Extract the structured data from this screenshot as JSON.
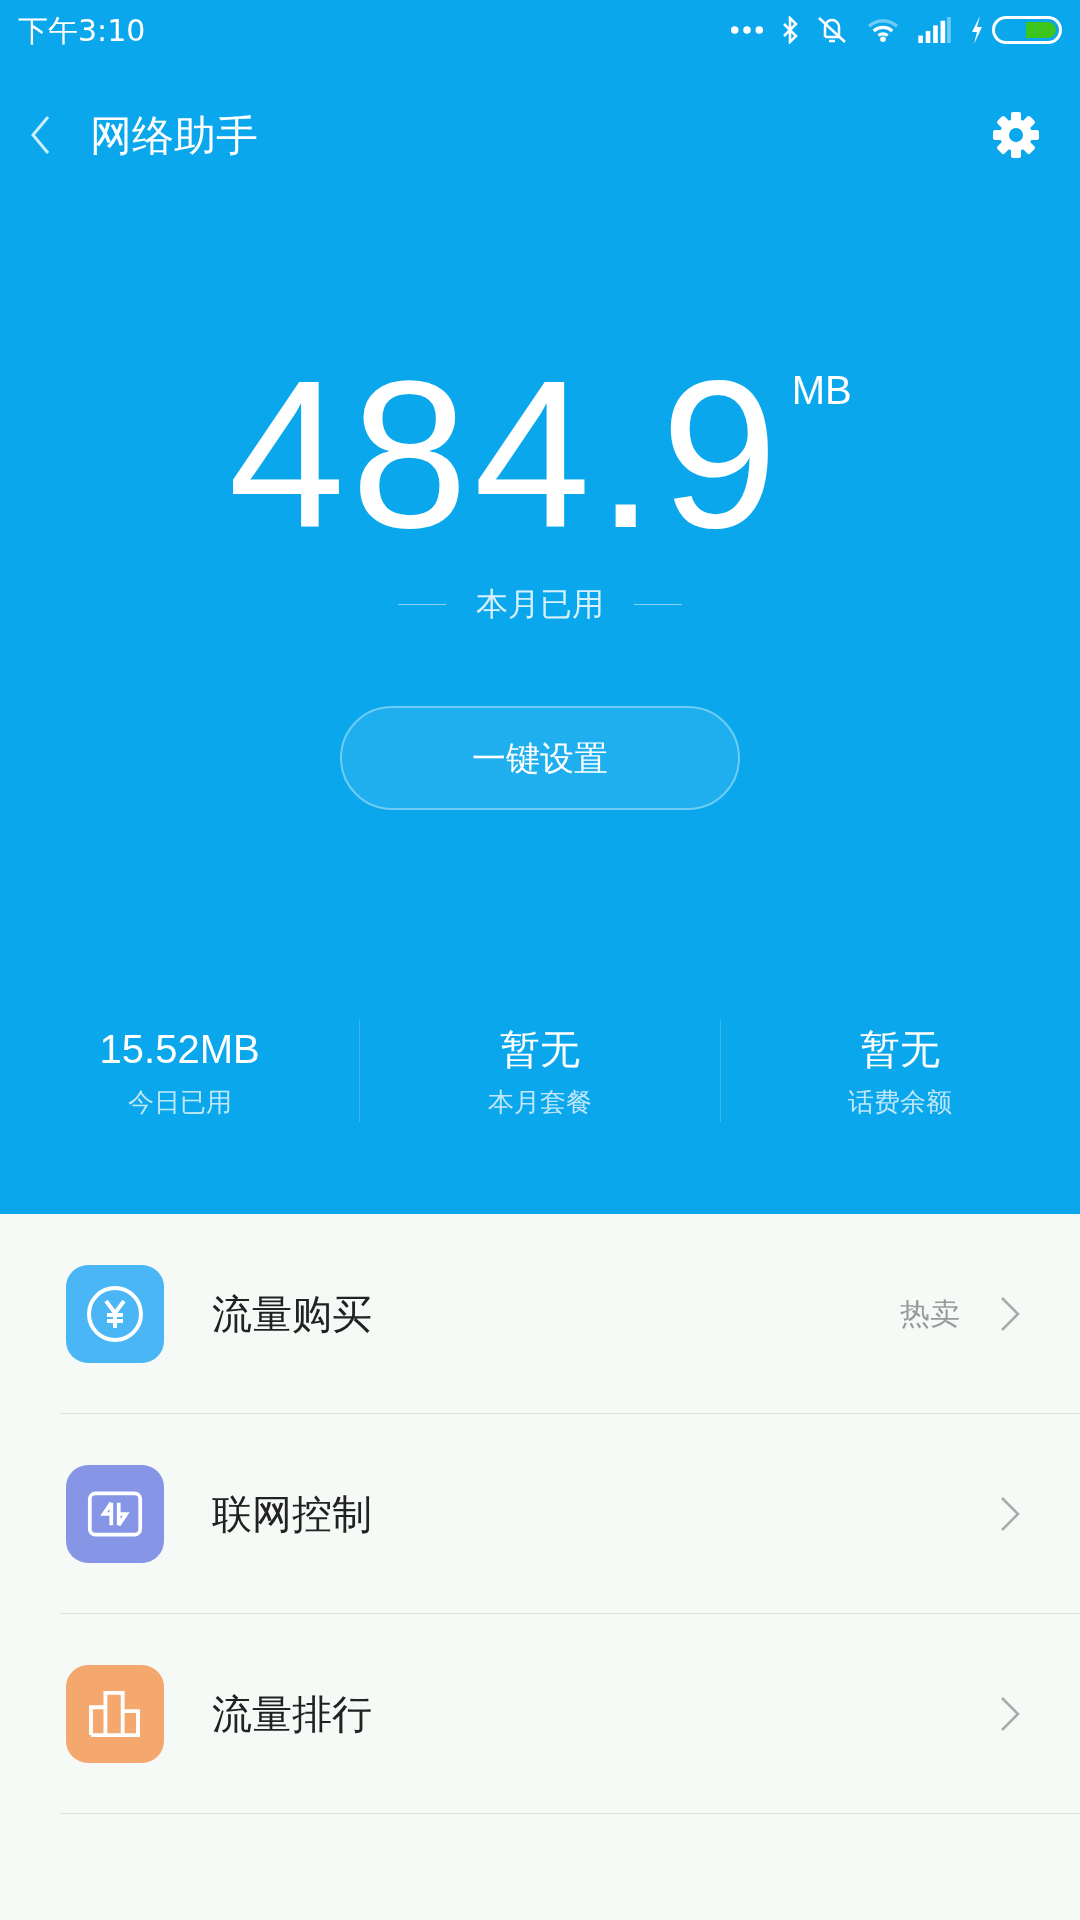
{
  "status_bar": {
    "time": "下午3:10"
  },
  "header": {
    "title": "网络助手"
  },
  "usage": {
    "value": "484.9",
    "unit": "MB",
    "caption": "本月已用"
  },
  "setup_button": "一键设置",
  "stats": [
    {
      "value": "15.52MB",
      "label": "今日已用"
    },
    {
      "value": "暂无",
      "label": "本月套餐"
    },
    {
      "value": "暂无",
      "label": "话费余额"
    }
  ],
  "menu": [
    {
      "kind": "purchase",
      "label": "流量购买",
      "badge": "热卖",
      "color": "#4bb6f5"
    },
    {
      "kind": "network",
      "label": "联网控制",
      "color": "#8795e6"
    },
    {
      "kind": "ranking",
      "label": "流量排行",
      "color": "#f5a86e"
    }
  ]
}
